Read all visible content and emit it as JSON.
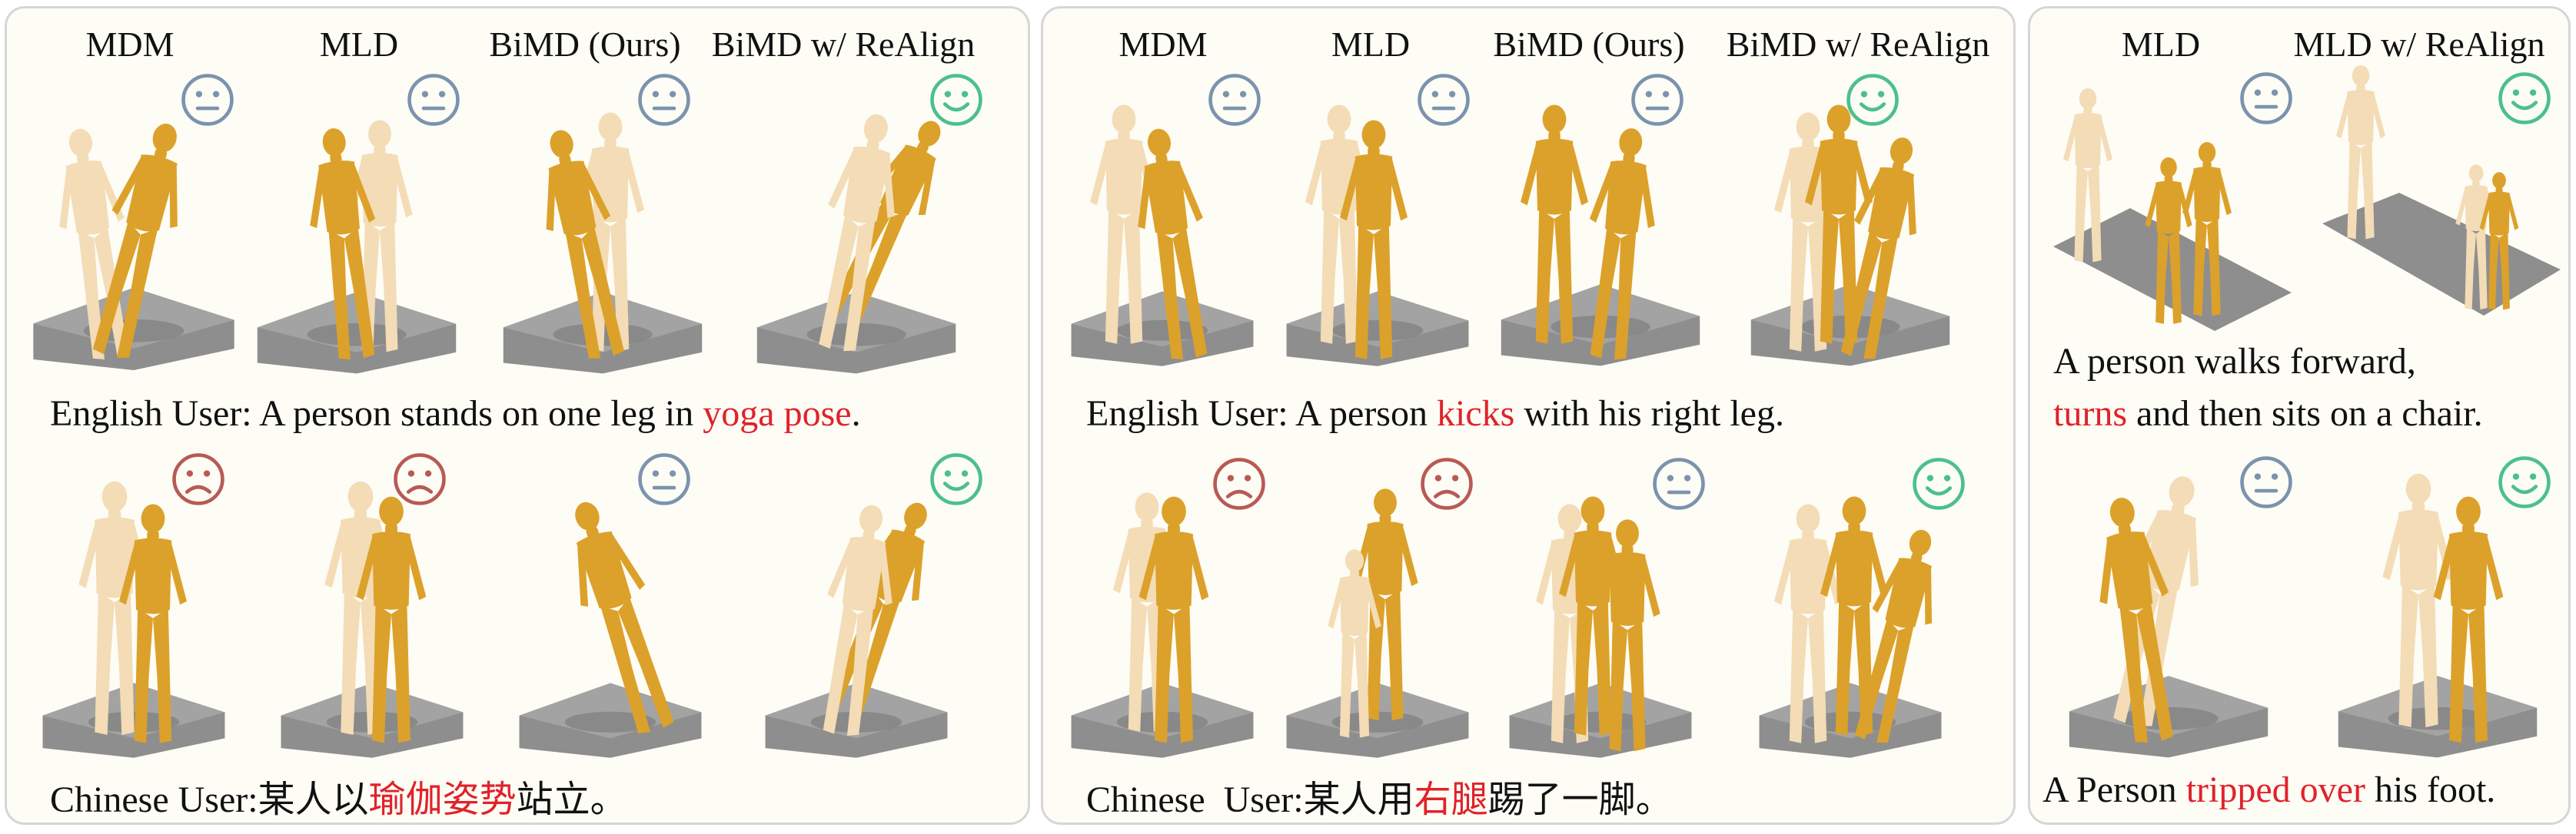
{
  "panel1": {
    "headers": [
      "MDM",
      "MLD",
      "BiMD (Ours)",
      "BiMD w/ ReAlign"
    ],
    "english": {
      "prefix": "English User: A person stands on one leg in ",
      "highlight": "yoga pose",
      "suffix": "."
    },
    "chinese": {
      "prefix": "Chinese User:",
      "pre2": "某人以",
      "highlight": "瑜伽姿势",
      "suffix": "站立。"
    },
    "row1_faces": [
      "neutral",
      "neutral",
      "neutral",
      "happy"
    ],
    "row2_faces": [
      "sad",
      "sad",
      "neutral",
      "happy"
    ]
  },
  "panel2": {
    "headers": [
      "MDM",
      "MLD",
      "BiMD (Ours)",
      "BiMD w/ ReAlign"
    ],
    "english": {
      "prefix": "English User: A person ",
      "highlight": "kicks",
      "suffix": " with his right leg."
    },
    "chinese": {
      "prefix": "Chinese  User:",
      "pre2": "某人用",
      "highlight": "右腿",
      "suffix": "踢了一脚。"
    },
    "row1_faces": [
      "neutral",
      "neutral",
      "neutral",
      "happy"
    ],
    "row2_faces": [
      "sad",
      "sad",
      "neutral",
      "happy"
    ]
  },
  "panel3": {
    "headers": [
      "MLD",
      "MLD w/ ReAlign"
    ],
    "caption1_line1": "A person walks forward,",
    "caption1_line2": {
      "highlight": "turns",
      "suffix": " and then sits on a chair."
    },
    "caption2": {
      "prefix": "A Person ",
      "highlight": "tripped over",
      "suffix": " his foot."
    },
    "row1_faces": [
      "neutral",
      "happy"
    ],
    "row2_faces": [
      "neutral",
      "happy"
    ]
  },
  "colors": {
    "neutral": "#7b93ad",
    "happy": "#4cc08a",
    "sad": "#b85a55",
    "highlight": "#e0222a",
    "body_dark": "#dca12a",
    "body_light": "#f3dcb6",
    "floor": "#8f8f8f"
  }
}
